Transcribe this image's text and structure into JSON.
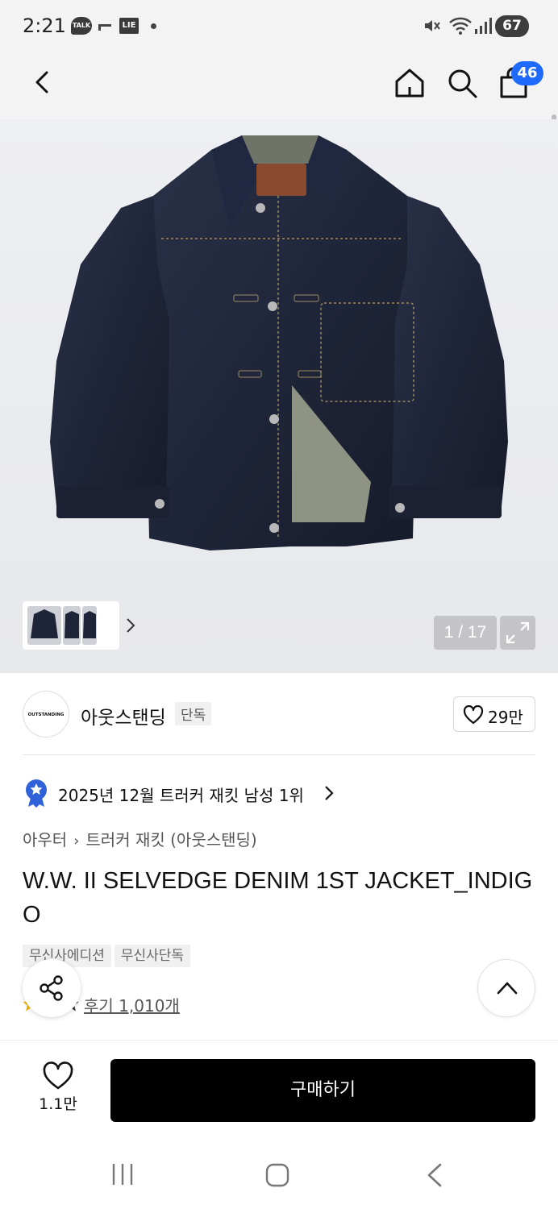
{
  "status_bar": {
    "time": "2:21",
    "talk_label": "TALK",
    "box_label": "LIE",
    "battery": "67"
  },
  "header": {
    "cart_count": "46"
  },
  "gallery": {
    "counter": "1 / 17"
  },
  "brand": {
    "logo_text": "OUTSTANDING",
    "name": "아웃스탠딩",
    "tag": "단독",
    "likes": "29만"
  },
  "ranking": {
    "text": "2025년 12월 트러커 재킷 남성 1위"
  },
  "breadcrumb": {
    "items": [
      "아우터",
      "트러커 재킷 (아웃스탠딩)"
    ]
  },
  "product": {
    "title": "W.W. II SELVEDGE DENIM 1ST JACKET_INDIGO",
    "tags": [
      "무신사에디션",
      "무신사단독"
    ],
    "review_link": "후기 1,010개"
  },
  "bottom_bar": {
    "wish_count": "1.1만",
    "buy_label": "구매하기"
  },
  "colors": {
    "accent": "#1f6bff",
    "buy_button": "#000000",
    "denim": "#1f2538"
  },
  "icons": [
    "back-icon",
    "home-icon",
    "search-icon",
    "shopping-bag-icon",
    "expand-icon",
    "heart-icon",
    "medal-icon",
    "chevron-right-icon",
    "share-icon",
    "chevron-up-icon",
    "star-icon",
    "recent-apps-icon",
    "android-home-icon",
    "android-back-icon"
  ]
}
